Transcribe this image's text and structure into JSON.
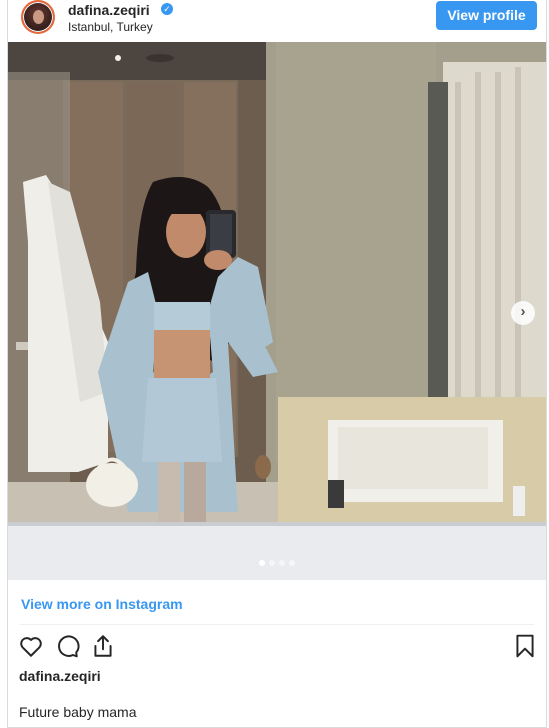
{
  "header": {
    "username": "dafina.zeqiri",
    "verified_icon": "verified-badge-icon",
    "location": "Istanbul, Turkey",
    "view_profile_label": "View profile"
  },
  "media": {
    "image_icon": "photo",
    "next_icon": "chevron-right-icon",
    "slide_count": 4,
    "active_slide": 1
  },
  "footer": {
    "view_more_label": "View more on Instagram",
    "actions": [
      "heart-icon",
      "comment-icon",
      "share-icon",
      "bookmark-icon"
    ],
    "author": "dafina.zeqiri",
    "caption": "Future baby mama"
  },
  "colors": {
    "accent": "#3897f0",
    "text": "#262626",
    "border": "#dbdbdb"
  }
}
